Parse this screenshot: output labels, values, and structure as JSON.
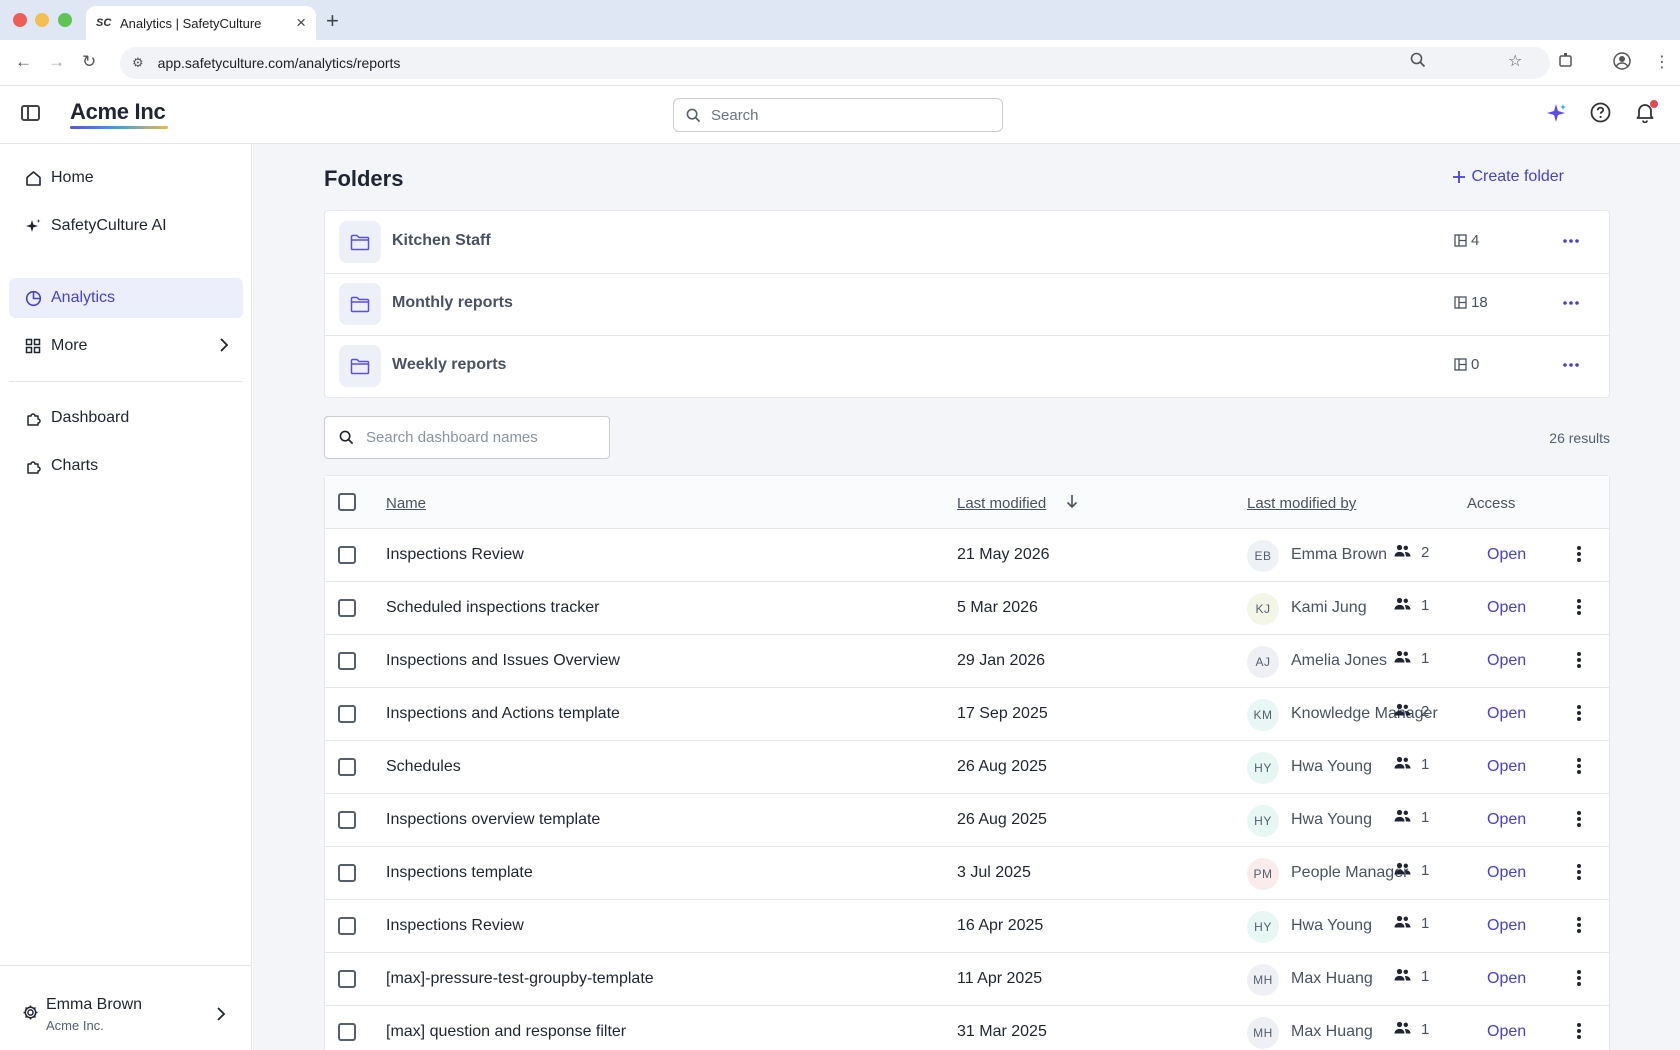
{
  "browser": {
    "tab_title": "Analytics | SafetyCulture",
    "tab_favicon": "SC",
    "new_tab": "+",
    "url": "app.safetyculture.com/analytics/reports"
  },
  "header": {
    "brand": "Acme Inc",
    "search_placeholder": "Search"
  },
  "sidebar": {
    "items": [
      {
        "label": "Home",
        "icon": "home-icon"
      },
      {
        "label": "SafetyCulture AI",
        "icon": "sparkle-icon"
      },
      {
        "label": "Analytics",
        "icon": "pie-chart-icon",
        "active": true
      },
      {
        "label": "More",
        "icon": "grid-icon"
      },
      {
        "label": "Dashboard",
        "icon": "puzzle-icon"
      },
      {
        "label": "Charts",
        "icon": "puzzle-icon"
      }
    ],
    "user": {
      "name": "Emma Brown",
      "org": "Acme Inc."
    }
  },
  "folders": {
    "title": "Folders",
    "create_label": "Create folder",
    "items": [
      {
        "name": "Kitchen Staff",
        "count": "4"
      },
      {
        "name": "Monthly reports",
        "count": "18"
      },
      {
        "name": "Weekly reports",
        "count": "0"
      }
    ]
  },
  "dashboards": {
    "search_placeholder": "Search dashboard names",
    "results": "26 results",
    "columns": {
      "name": "Name",
      "last_modified": "Last modified",
      "last_modified_by": "Last modified by",
      "access": "Access"
    },
    "open_label": "Open",
    "rows": [
      {
        "name": "Inspections Review",
        "date": "21 May 2026",
        "initials": "EB",
        "by": "Emma Brown",
        "access": "2",
        "avatar_color": "#eef2f6"
      },
      {
        "name": "Scheduled inspections tracker",
        "date": "5 Mar 2026",
        "initials": "KJ",
        "by": "Kami Jung",
        "access": "1",
        "avatar_color": "#f3f5e6"
      },
      {
        "name": "Inspections and Issues Overview",
        "date": "29 Jan 2026",
        "initials": "AJ",
        "by": "Amelia Jones",
        "access": "1",
        "avatar_color": "#eef0f6"
      },
      {
        "name": "Inspections and Actions template",
        "date": "17 Sep 2025",
        "initials": "KM",
        "by": "Knowledge Manager",
        "access": "2",
        "avatar_color": "#e8f6f6"
      },
      {
        "name": "Schedules",
        "date": "26 Aug 2025",
        "initials": "HY",
        "by": "Hwa Young",
        "access": "1",
        "avatar_color": "#e6f7f4"
      },
      {
        "name": "Inspections overview template",
        "date": "26 Aug 2025",
        "initials": "HY",
        "by": "Hwa Young",
        "access": "1",
        "avatar_color": "#e6f7f4"
      },
      {
        "name": "Inspections template",
        "date": "3 Jul 2025",
        "initials": "PM",
        "by": "People Manager",
        "access": "1",
        "avatar_color": "#fbecec"
      },
      {
        "name": "Inspections Review",
        "date": "16 Apr 2025",
        "initials": "HY",
        "by": "Hwa Young",
        "access": "1",
        "avatar_color": "#e6f7f4"
      },
      {
        "name": "[max]-pressure-test-groupby-template",
        "date": "11 Apr 2025",
        "initials": "MH",
        "by": "Max Huang",
        "access": "1",
        "avatar_color": "#eef0f6"
      },
      {
        "name": "[max] question and response filter",
        "date": "31 Mar 2025",
        "initials": "MH",
        "by": "Max Huang",
        "access": "1",
        "avatar_color": "#eef0f6"
      }
    ]
  },
  "colors": {
    "accent": "#4740d4",
    "active_bg": "#eceffb",
    "notification": "#e5484d"
  }
}
